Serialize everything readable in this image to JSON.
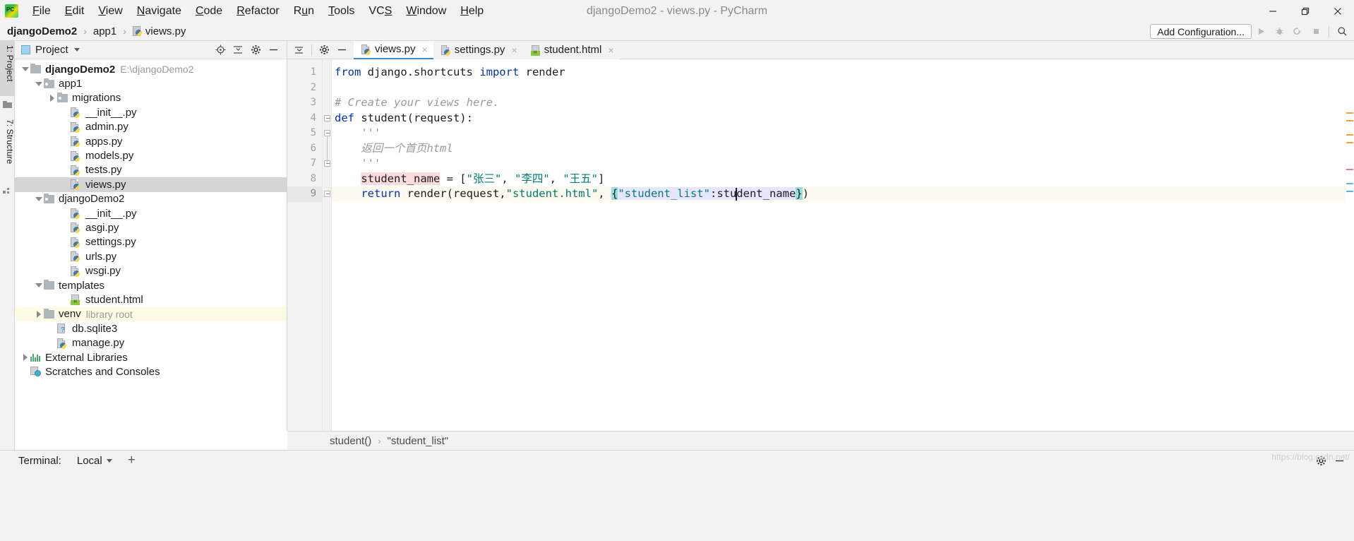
{
  "window": {
    "title": "djangoDemo2 - views.py - PyCharm",
    "app_logo": "pycharm-logo",
    "minimize": "minimize-icon",
    "maximize": "restore-icon",
    "close": "close-icon"
  },
  "menubar": {
    "items": [
      {
        "label": "File",
        "mnemonic": "F"
      },
      {
        "label": "Edit",
        "mnemonic": "E"
      },
      {
        "label": "View",
        "mnemonic": "V"
      },
      {
        "label": "Navigate",
        "mnemonic": "N"
      },
      {
        "label": "Code",
        "mnemonic": "C"
      },
      {
        "label": "Refactor",
        "mnemonic": "R"
      },
      {
        "label": "Run",
        "mnemonic": "u"
      },
      {
        "label": "Tools",
        "mnemonic": "T"
      },
      {
        "label": "VCS",
        "mnemonic": "S"
      },
      {
        "label": "Window",
        "mnemonic": "W"
      },
      {
        "label": "Help",
        "mnemonic": "H"
      }
    ]
  },
  "breadcrumb": {
    "items": [
      {
        "label": "djangoDemo2",
        "icon": null
      },
      {
        "label": "app1",
        "icon": null
      },
      {
        "label": "views.py",
        "icon": "python-file-icon"
      }
    ],
    "separator": "›"
  },
  "toolbar": {
    "add_configuration": "Add Configuration...",
    "run": "run-icon",
    "debug": "debug-icon",
    "run_coverage": "run-with-coverage-icon",
    "stop": "stop-icon",
    "search_everywhere": "search-icon"
  },
  "tool_strip": {
    "project_tab": "1: Project",
    "structure_tab": "7: Structure"
  },
  "project_panel": {
    "title": "Project",
    "dropdown": "chevron-down-icon",
    "actions": [
      "locate-icon",
      "collapse-all-icon",
      "settings-icon",
      "hide-icon"
    ],
    "tree": [
      {
        "label": "djangoDemo2",
        "path_hint": "E:\\djangoDemo2",
        "indent": 0,
        "arrow": "down",
        "icon": "folder",
        "bold": true,
        "selected": false,
        "highlight": false
      },
      {
        "label": "app1",
        "path_hint": "",
        "indent": 1,
        "arrow": "down",
        "icon": "folder-module",
        "bold": false,
        "selected": false,
        "highlight": false
      },
      {
        "label": "migrations",
        "path_hint": "",
        "indent": 2,
        "arrow": "right",
        "icon": "folder-module",
        "bold": false,
        "selected": false,
        "highlight": false
      },
      {
        "label": "__init__.py",
        "path_hint": "",
        "indent": 3,
        "arrow": "none",
        "icon": "python-file",
        "bold": false,
        "selected": false,
        "highlight": false
      },
      {
        "label": "admin.py",
        "path_hint": "",
        "indent": 3,
        "arrow": "none",
        "icon": "python-file",
        "bold": false,
        "selected": false,
        "highlight": false
      },
      {
        "label": "apps.py",
        "path_hint": "",
        "indent": 3,
        "arrow": "none",
        "icon": "python-file",
        "bold": false,
        "selected": false,
        "highlight": false
      },
      {
        "label": "models.py",
        "path_hint": "",
        "indent": 3,
        "arrow": "none",
        "icon": "python-file",
        "bold": false,
        "selected": false,
        "highlight": false
      },
      {
        "label": "tests.py",
        "path_hint": "",
        "indent": 3,
        "arrow": "none",
        "icon": "python-file",
        "bold": false,
        "selected": false,
        "highlight": false
      },
      {
        "label": "views.py",
        "path_hint": "",
        "indent": 3,
        "arrow": "none",
        "icon": "python-file",
        "bold": false,
        "selected": true,
        "highlight": false
      },
      {
        "label": "djangoDemo2",
        "path_hint": "",
        "indent": 1,
        "arrow": "down",
        "icon": "folder-module",
        "bold": false,
        "selected": false,
        "highlight": false
      },
      {
        "label": "__init__.py",
        "path_hint": "",
        "indent": 3,
        "arrow": "none",
        "icon": "python-file",
        "bold": false,
        "selected": false,
        "highlight": false
      },
      {
        "label": "asgi.py",
        "path_hint": "",
        "indent": 3,
        "arrow": "none",
        "icon": "python-file",
        "bold": false,
        "selected": false,
        "highlight": false
      },
      {
        "label": "settings.py",
        "path_hint": "",
        "indent": 3,
        "arrow": "none",
        "icon": "python-file",
        "bold": false,
        "selected": false,
        "highlight": false
      },
      {
        "label": "urls.py",
        "path_hint": "",
        "indent": 3,
        "arrow": "none",
        "icon": "python-file",
        "bold": false,
        "selected": false,
        "highlight": false
      },
      {
        "label": "wsgi.py",
        "path_hint": "",
        "indent": 3,
        "arrow": "none",
        "icon": "python-file",
        "bold": false,
        "selected": false,
        "highlight": false
      },
      {
        "label": "templates",
        "path_hint": "",
        "indent": 1,
        "arrow": "down",
        "icon": "folder",
        "bold": false,
        "selected": false,
        "highlight": false
      },
      {
        "label": "student.html",
        "path_hint": "",
        "indent": 3,
        "arrow": "none",
        "icon": "html-file",
        "bold": false,
        "selected": false,
        "highlight": false
      },
      {
        "label": "venv",
        "path_hint": "library root",
        "indent": 1,
        "arrow": "right",
        "icon": "folder",
        "bold": false,
        "selected": false,
        "highlight": true
      },
      {
        "label": "db.sqlite3",
        "path_hint": "",
        "indent": 2,
        "arrow": "none",
        "icon": "unknown-file",
        "bold": false,
        "selected": false,
        "highlight": false
      },
      {
        "label": "manage.py",
        "path_hint": "",
        "indent": 2,
        "arrow": "none",
        "icon": "python-file",
        "bold": false,
        "selected": false,
        "highlight": false
      },
      {
        "label": "External Libraries",
        "path_hint": "",
        "indent": 0,
        "arrow": "right",
        "icon": "libraries",
        "bold": false,
        "selected": false,
        "highlight": false
      },
      {
        "label": "Scratches and Consoles",
        "path_hint": "",
        "indent": 0,
        "arrow": "none",
        "icon": "scratches",
        "bold": false,
        "selected": false,
        "highlight": false
      }
    ]
  },
  "editor": {
    "left_actions": [
      "expand-collapse-icon",
      "settings-icon",
      "hide-icon"
    ],
    "tabs": [
      {
        "label": "views.py",
        "icon": "python-file-icon",
        "active": true,
        "close": "×"
      },
      {
        "label": "settings.py",
        "icon": "python-file-icon",
        "active": false,
        "close": "×"
      },
      {
        "label": "student.html",
        "icon": "html-file-icon",
        "active": false,
        "close": "×"
      }
    ],
    "line_numbers": [
      "1",
      "2",
      "3",
      "4",
      "5",
      "6",
      "7",
      "8",
      "9"
    ],
    "current_line": 9,
    "lines": [
      {
        "n": 1,
        "tokens": [
          {
            "t": "from",
            "c": "kw"
          },
          {
            "t": " django.shortcuts ",
            "c": ""
          },
          {
            "t": "import",
            "c": "kw"
          },
          {
            "t": " render",
            "c": ""
          }
        ]
      },
      {
        "n": 2,
        "tokens": []
      },
      {
        "n": 3,
        "tokens": [
          {
            "t": "# Create your views here.",
            "c": "cmt"
          }
        ]
      },
      {
        "n": 4,
        "tokens": [
          {
            "t": "def",
            "c": "kw"
          },
          {
            "t": " student(request):",
            "c": ""
          }
        ]
      },
      {
        "n": 5,
        "tokens": [
          {
            "t": "    '''",
            "c": "doc"
          }
        ]
      },
      {
        "n": 6,
        "tokens": [
          {
            "t": "    返回一个首页html",
            "c": "doc"
          }
        ]
      },
      {
        "n": 7,
        "tokens": [
          {
            "t": "    '''",
            "c": "doc"
          }
        ]
      },
      {
        "n": 8,
        "tokens": [
          {
            "t": "    ",
            "c": ""
          },
          {
            "t": "student_name",
            "c": "var-hl"
          },
          {
            "t": " = [",
            "c": ""
          },
          {
            "t": "\"张三\"",
            "c": "str"
          },
          {
            "t": ", ",
            "c": ""
          },
          {
            "t": "\"李四\"",
            "c": "str"
          },
          {
            "t": ", ",
            "c": ""
          },
          {
            "t": "\"王五\"",
            "c": "str"
          },
          {
            "t": "]",
            "c": ""
          }
        ]
      },
      {
        "n": 9,
        "tokens": [
          {
            "t": "    ",
            "c": ""
          },
          {
            "t": "return",
            "c": "kw"
          },
          {
            "t": " render(request,",
            "c": ""
          },
          {
            "t": "\"student.html\"",
            "c": "str"
          },
          {
            "t": ", ",
            "c": ""
          },
          {
            "t": "{",
            "c": "brace-hl"
          },
          {
            "t": "\"student_list\"",
            "c": "str dict-hl"
          },
          {
            "t": ":",
            "c": "dict-hl"
          },
          {
            "t": "student_name",
            "c": "dict-hl"
          },
          {
            "t": "}",
            "c": "brace-hl"
          },
          {
            "t": ")",
            "c": ""
          }
        ]
      }
    ],
    "raw_code": "from django.shortcuts import render\n\n# Create your views here.\ndef student(request):\n    '''\n    返回一个首页html\n    '''\n    student_name = [\"张三\", \"李四\", \"王五\"]\n    return render(request,\"student.html\", {\"student_list\":student_name})"
  },
  "editor_breadcrumb": {
    "items": [
      "student()",
      "\"student_list\""
    ],
    "separator": "›"
  },
  "statusbar": {
    "terminal_label": "Terminal:",
    "local_label": "Local",
    "local_dropdown": "chevron-down-icon",
    "add": "plus-icon",
    "settings": "gear-icon",
    "hide": "hide-icon",
    "watermark": "https://blog.csdn.net/"
  },
  "colors": {
    "accent": "#3a8cc8",
    "keyword": "#0033b3",
    "string": "#017d73",
    "comment": "#9a9a9a",
    "selection": "#d4d4d4",
    "library_root": "#fdfbe4",
    "brace_match": "#93e0e3",
    "dict_highlight": "#e8e6ff",
    "var_highlight": "#fbdbdb"
  }
}
